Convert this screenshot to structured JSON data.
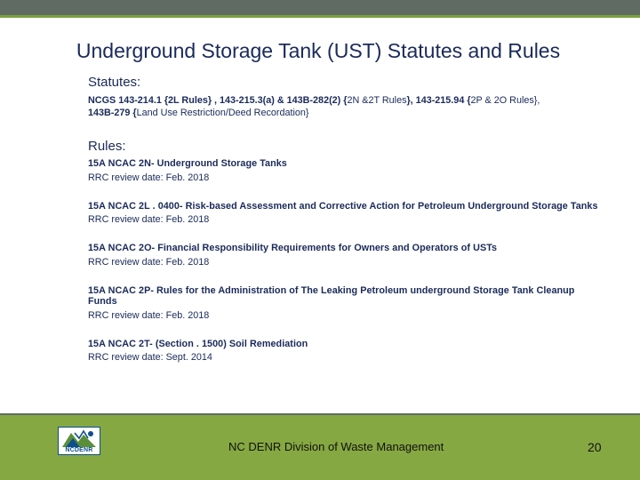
{
  "slide": {
    "title": "Underground Storage Tank (UST) Statutes and Rules"
  },
  "statutes": {
    "heading": "Statutes:",
    "line1_part1": "NCGS 143-214.1 {2L Rules} , 143-215.3(a) & 143B-282(2) {",
    "line1_part2": "2N &2T Rules",
    "line1_part3": "}, 143-215.94 {",
    "line1_part4": "2P & 2O Rules",
    "line1_part5": "},",
    "line2_part1": "143B-279 {",
    "line2_part2": "Land Use Restriction/Deed Recordation",
    "line2_part3": "}"
  },
  "rules": {
    "heading": "Rules:",
    "items": [
      {
        "title": "15A NCAC 2N-  Underground Storage Tanks",
        "review": "RRC review date: Feb. 2018"
      },
      {
        "title": "15A NCAC 2L . 0400-  Risk-based Assessment and Corrective Action for Petroleum Underground Storage Tanks",
        "review": "RRC review date: Feb. 2018"
      },
      {
        "title": "15A NCAC 2O-  Financial Responsibility Requirements for Owners and Operators of USTs",
        "review": "RRC review date: Feb. 2018"
      },
      {
        "title": "15A NCAC 2P-  Rules for the Administration of The Leaking Petroleum underground Storage Tank Cleanup Funds",
        "review": "RRC review date: Feb. 2018"
      },
      {
        "title": "15A NCAC 2T-  (Section . 1500) Soil Remediation",
        "review": "RRC review date: Sept. 2014"
      }
    ]
  },
  "footer": {
    "logo_text": "NCDENR",
    "organization": "NC DENR Division of Waste Management",
    "page_number": "20"
  },
  "colors": {
    "title": "#1a2a5a",
    "top_bar": "#5f6b63",
    "accent_green": "#7aa33c",
    "footer_green": "#86a842",
    "logo_blue": "#0d4f8b"
  }
}
